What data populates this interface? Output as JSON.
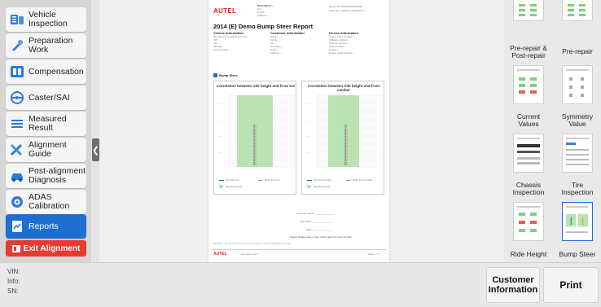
{
  "sidebar": {
    "items": [
      {
        "label": "Vehicle\nInspection",
        "l1": "Vehicle",
        "l2": "Inspection",
        "icon": "vehicle-inspection-icon"
      },
      {
        "l1": "Preparation",
        "l2": "Work",
        "icon": "wrench-icon"
      },
      {
        "l1": "Compensation",
        "l2": "",
        "icon": "compensation-icon"
      },
      {
        "l1": "Caster/SAI",
        "l2": "",
        "icon": "steering-wheel-icon"
      },
      {
        "l1": "Measured",
        "l2": "Result",
        "icon": "list-icon"
      },
      {
        "l1": "Alignment",
        "l2": "Guide",
        "icon": "tools-icon"
      },
      {
        "l1": "Post-alignment",
        "l2": "Diagnosis",
        "icon": "car-icon"
      },
      {
        "l1": "ADAS",
        "l2": "Calibration",
        "icon": "adas-icon"
      },
      {
        "l1": "Reports",
        "l2": "",
        "icon": "report-icon"
      }
    ],
    "exit_label": "Exit Alignment"
  },
  "report": {
    "brand": "AUTEL",
    "shop_name": "Shop Name: --",
    "shop_tel": "Tel: --",
    "shop_email": "Email: --",
    "shop_addr": "Address: --",
    "report_meta1": "Report ID: 2023061301010111",
    "report_meta2": "Date/Time: 2023-06-13 09:10:11",
    "title": "2014 (E) Demo Bump Steer Report",
    "vehicle_head": "Vehicle information",
    "vehicle_l1": "2014 (E) Demo Model 2.0T 4x4",
    "vehicle_l2": "VIN: --",
    "vehicle_l3": "Info: --",
    "vehicle_l4": "Mileage: --",
    "vehicle_l5": "License Plate: --",
    "customer_head": "Customer information",
    "customer_l1": "Owner: --",
    "customer_l2": "Mobile: --",
    "customer_l3": "Tel: --",
    "customer_l4": "Company: --",
    "customer_l5": "Email: --",
    "customer_l6": "Address: --",
    "device_head": "Device information",
    "device_l1": "Report Index Number: --",
    "device_l2": "Software Version: --",
    "device_l3": "Scanner Version: --",
    "device_l4": "Serial number: --",
    "device_l5": "Engine: --",
    "device_l6": "Engine serial number: --",
    "section": "Bump Steer",
    "chart1_title": "Correlation between ride height and front toe",
    "chart2_title": "Correlation between ride height and front camber",
    "legend1_left": "Left front toe",
    "legend1_right": "Right front toe",
    "legend1_spec": "Specified range",
    "legend2_left": "Left front camber",
    "legend2_right": "Right front camber",
    "legend2_spec": "Specified range",
    "sig_customer": "Customer name: ______________",
    "sig_tech": "Technician: ______________",
    "sig_date": "Date: ______________",
    "note": "Notice: Please save a copy of this report for your records.",
    "disclaimer": "Disclaimer: The test report is only for the reference of vehicle inspection and repair.",
    "footer_brand": "AUTEL",
    "footer_url": "www.autel.com",
    "footer_page": "Page 1 / 1"
  },
  "colors": {
    "accent": "#1e6fd0",
    "exit": "#e83a2f",
    "brand": "#e2231a",
    "spec_band": "#b9e3b0",
    "series_left": "#3a5fd0",
    "series_right": "#e09a2a"
  },
  "thumbnails": [
    {
      "label": "",
      "l1": "",
      "l2": ""
    },
    {
      "l1": "",
      "l2": ""
    },
    {
      "l1": "Pre-repair &",
      "l2": "Post-repair"
    },
    {
      "l1": "Pre-repair",
      "l2": ""
    },
    {
      "l1": "Current",
      "l2": "Values"
    },
    {
      "l1": "Symmetry",
      "l2": "Value"
    },
    {
      "l1": "Chassis",
      "l2": "Inspection"
    },
    {
      "l1": "Tire",
      "l2": "Inspection"
    },
    {
      "l1": "Ride Height",
      "l2": ""
    },
    {
      "l1": "Bump Steer",
      "l2": ""
    }
  ],
  "bottom": {
    "vin": "VIN:",
    "info": "Info:",
    "sn": "SN:",
    "customer_btn_l1": "Customer",
    "customer_btn_l2": "Information",
    "print_btn": "Print"
  }
}
